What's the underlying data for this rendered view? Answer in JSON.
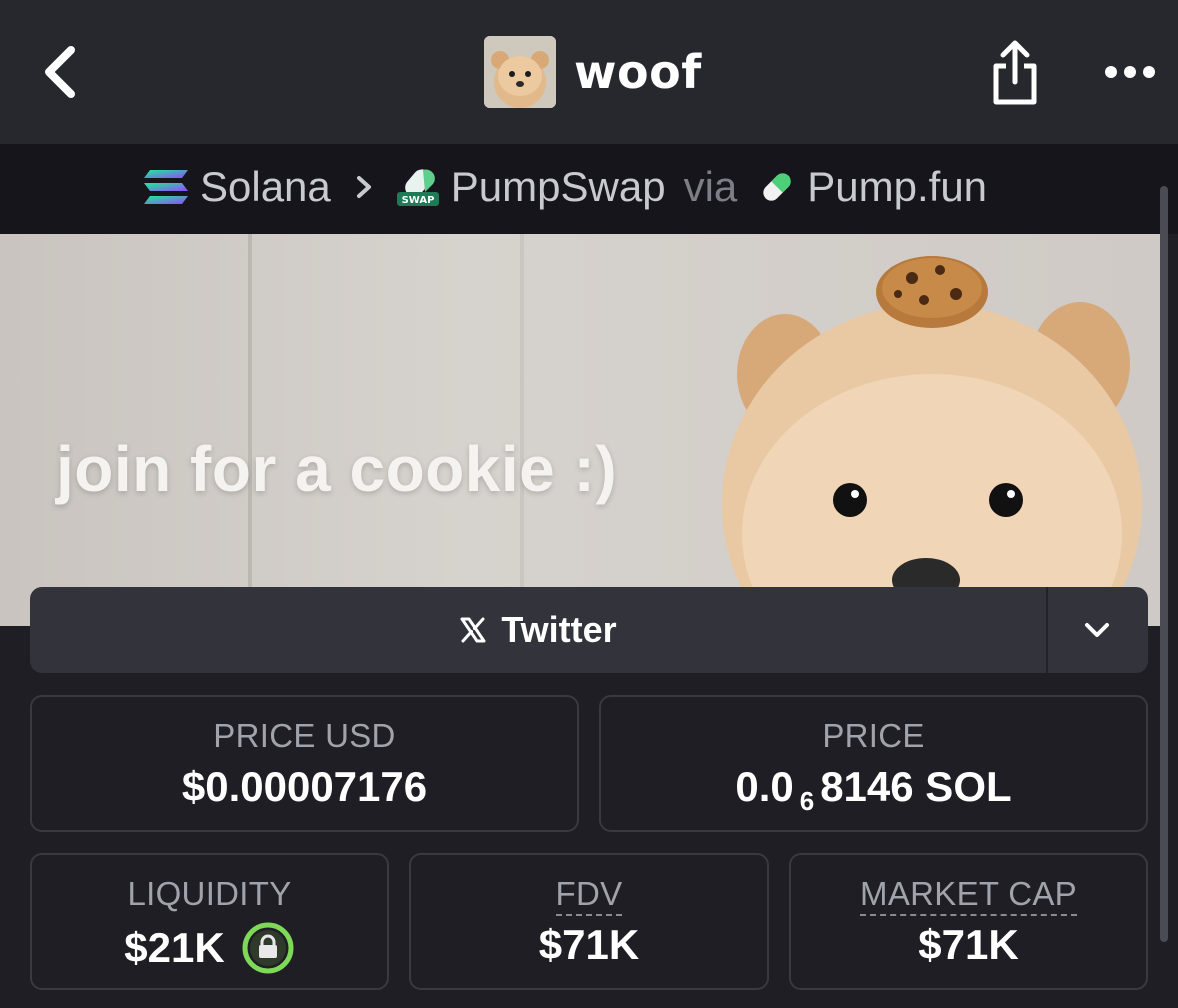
{
  "header": {
    "title": "woof",
    "back_icon": "chevron-left-icon",
    "share_icon": "share-icon",
    "more_icon": "more-horizontal-icon"
  },
  "breadcrumb": {
    "chain": "Solana",
    "dex": "PumpSwap",
    "via_label": "via",
    "launchpad": "Pump.fun"
  },
  "banner": {
    "text": "join for a cookie :)"
  },
  "social": {
    "twitter_label": "Twitter"
  },
  "stats": {
    "price_usd_label": "PRICE USD",
    "price_usd_value": "$0.00007176",
    "price_label": "PRICE",
    "price_prefix": "0.0",
    "price_subscript": "6",
    "price_suffix": "8146 SOL",
    "liquidity_label": "LIQUIDITY",
    "liquidity_value": "$21K",
    "fdv_label": "FDV",
    "fdv_value": "$71K",
    "market_cap_label": "MARKET CAP",
    "market_cap_value": "$71K"
  },
  "colors": {
    "accent_green": "#7ed957",
    "bg": "#1e1e24"
  }
}
